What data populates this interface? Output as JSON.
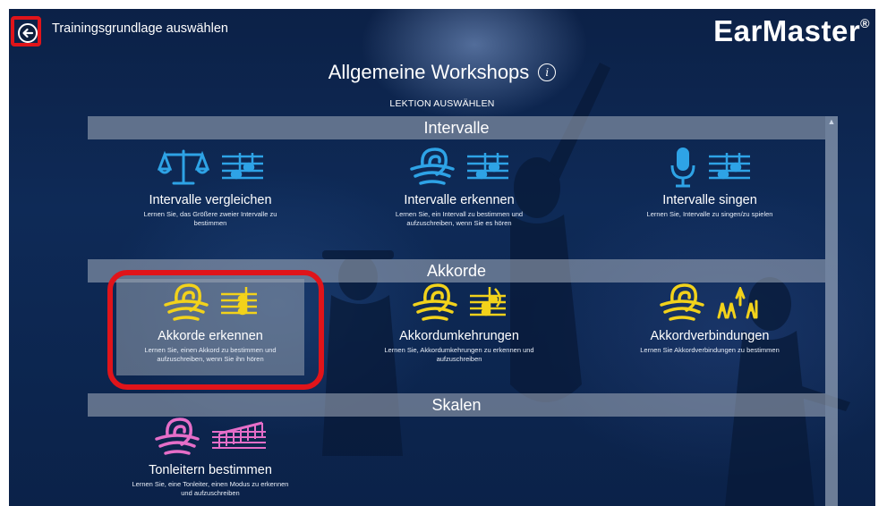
{
  "header": {
    "breadcrumb": "Trainingsgrundlage auswählen",
    "logo": "EarMaster",
    "logo_mark": "®"
  },
  "page": {
    "title": "Allgemeine Workshops",
    "subtitle": "LEKTION AUSWÄHLEN"
  },
  "sections": [
    {
      "title": "Intervalle",
      "tiles": [
        {
          "name": "Intervalle vergleichen",
          "desc": "Lernen Sie, das Größere zweier Intervalle zu bestimmen",
          "icon": "scale-icon",
          "color": "#2ea3e6"
        },
        {
          "name": "Intervalle erkennen",
          "desc": "Lernen Sie, ein Intervall zu bestimmen und aufzuschreiben, wenn Sie es hören",
          "icon": "ear-icon",
          "color": "#2ea3e6"
        },
        {
          "name": "Intervalle singen",
          "desc": "Lernen Sie, Intervalle zu singen/zu spielen",
          "icon": "microphone-icon",
          "color": "#2ea3e6"
        }
      ]
    },
    {
      "title": "Akkorde",
      "tiles": [
        {
          "name": "Akkorde erkennen",
          "desc": "Lernen Sie, einen Akkord zu bestimmen und aufzuschreiben, wenn Sie ihn hören",
          "icon": "ear-icon",
          "color": "#f2d21b",
          "selected": true
        },
        {
          "name": "Akkordumkehrungen",
          "desc": "Lernen Sie, Akkordumkehrungen zu erkennen und aufzuschreiben",
          "icon": "ear-icon",
          "color": "#f2d21b"
        },
        {
          "name": "Akkordverbindungen",
          "desc": "Lernen Sie Akkordverbindungen zu bestimmen",
          "icon": "ear-icon",
          "color": "#f2d21b"
        }
      ]
    },
    {
      "title": "Skalen",
      "tiles": [
        {
          "name": "Tonleitern bestimmen",
          "desc": "Lernen Sie, eine Tonleiter, einen Modus zu erkennen und aufzuschreiben",
          "icon": "ear-icon",
          "color": "#e66ec8"
        }
      ]
    }
  ],
  "colors": {
    "intervals": "#2ea3e6",
    "chords": "#f2d21b",
    "scales": "#e66ec8",
    "highlight": "#e0141a"
  }
}
